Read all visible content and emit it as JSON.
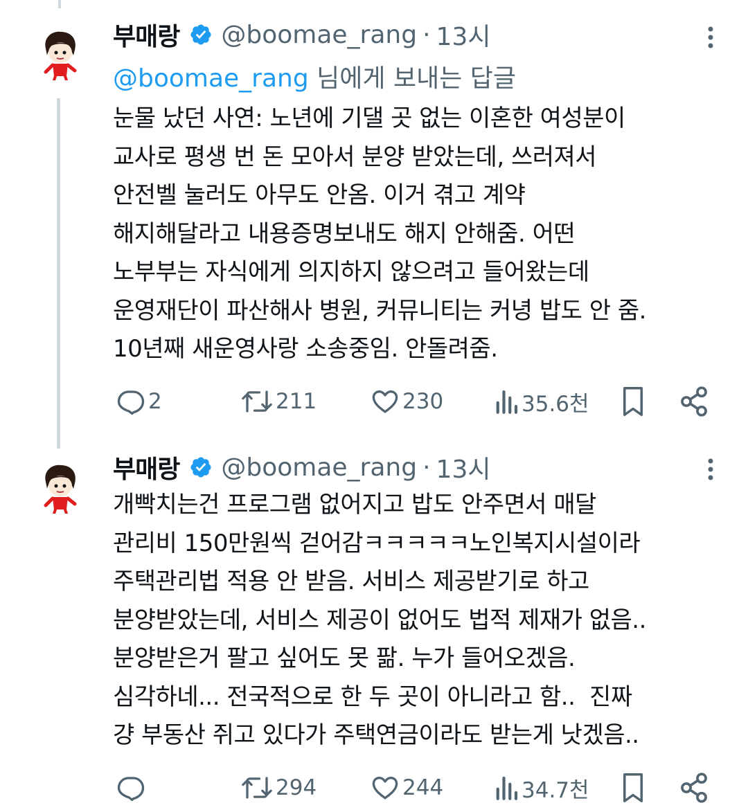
{
  "tweets": [
    {
      "name": "부매랑",
      "handle": "@boomae_rang",
      "separator": "·",
      "time": "13시",
      "reply_to": {
        "mention": "@boomae_rang",
        "suffix": " 님에게 보내는 답글"
      },
      "text": "눈물 났던 사연: 노년에 기댈 곳 없는 이혼한 여성분이\n교사로 평생 번 돈 모아서 분양 받았는데, 쓰러져서\n안전벨 눌러도 아무도 안옴. 이거 겪고 계약\n해지해달라고 내용증명보내도 해지 안해줌. 어떤\n노부부는 자식에게 의지하지 않으려고 들어왔는데\n운영재단이 파산해사 병원, 커뮤니티는 커녕 밥도 안 줌.\n10년째 새운영사랑 소송중임. 안돌려줌.",
      "replies": "2",
      "retweets": "211",
      "likes": "230",
      "views": "35.6천"
    },
    {
      "name": "부매랑",
      "handle": "@boomae_rang",
      "separator": "·",
      "time": "13시",
      "text": "개빡치는건 프로그램 없어지고 밥도 안주면서 매달\n관리비 150만원씩 걷어감ㅋㅋㅋㅋㅋ노인복지시설이라\n주택관리법 적용 안 받음. 서비스 제공받기로 하고\n분양받았는데, 서비스 제공이 없어도 법적 제재가 없음..\n분양받은거 팔고 싶어도 못 팖. 누가 들어오겠음.\n심각하네... 전국적으로 한 두 곳이 아니라고 함..  진짜\n걍 부동산 쥐고 있다가 주택연금이라도 받는게 낫겠음..",
      "replies": "",
      "retweets": "294",
      "likes": "244",
      "views": "34.7천"
    }
  ],
  "icons": {
    "verified": "verified-badge-icon",
    "more": "more-options-icon",
    "reply": "reply-icon",
    "retweet": "retweet-icon",
    "like": "heart-icon",
    "views": "views-chart-icon",
    "bookmark": "bookmark-icon",
    "share": "share-icon"
  },
  "colors": {
    "accent": "#1d9bf0",
    "secondary_text": "#536471",
    "text": "#0f1419",
    "thread_line": "#cfd9de"
  }
}
